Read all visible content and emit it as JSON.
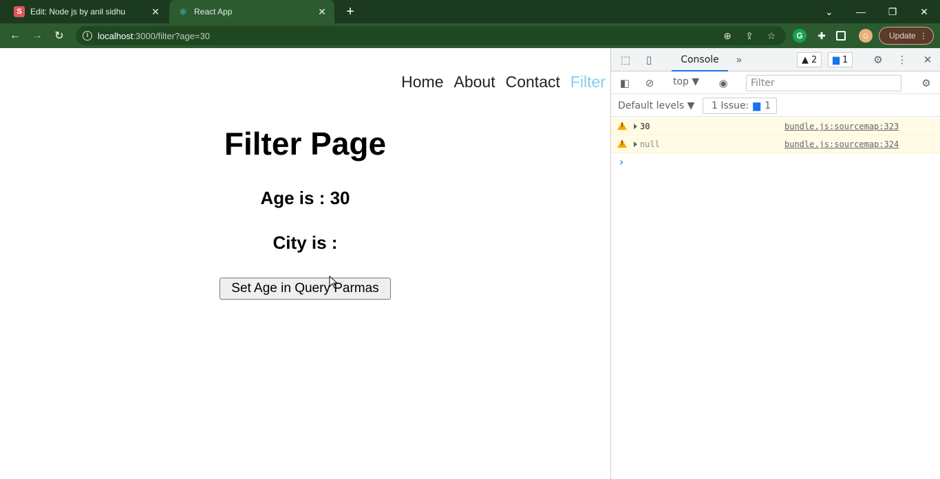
{
  "browser": {
    "tabs": [
      {
        "title": "Edit: Node js by anil sidhu",
        "favicon": "S"
      },
      {
        "title": "React App",
        "favicon": "⚛"
      }
    ],
    "url_host": "localhost",
    "url_rest": ":3000/filter?age=30",
    "update_label": "Update"
  },
  "page": {
    "nav": [
      "Home",
      "About",
      "Contact",
      "Filter"
    ],
    "title": "Filter Page",
    "age_line": "Age is : 30",
    "city_line": "City is :",
    "button_label": "Set Age in Query Parmas"
  },
  "devtools": {
    "tab_console": "Console",
    "warn_count": "2",
    "msg_count": "1",
    "context": "top ▼",
    "filter_placeholder": "Filter",
    "levels": "Default levels ▼",
    "issues_label": "1 Issue:",
    "issues_count": "1",
    "logs": [
      {
        "value": "30",
        "source": "bundle.js:sourcemap:323"
      },
      {
        "value": "null",
        "source": "bundle.js:sourcemap:324"
      }
    ]
  },
  "colors": {
    "tabbar": "#1c3a1f",
    "toolbar": "#2b5b2f",
    "nav_active": "#87ceeb",
    "warn_bg": "#fffbe5"
  }
}
